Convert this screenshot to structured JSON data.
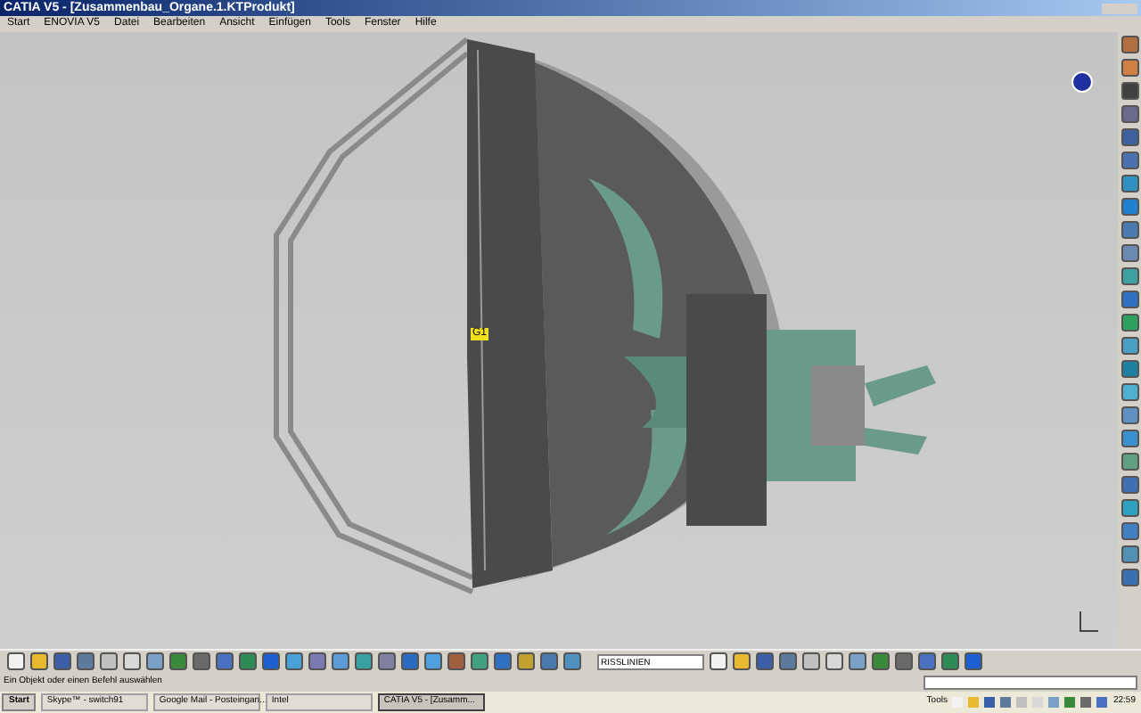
{
  "window": {
    "title": "CATIA V5 - [Zusammenbau_Organe.1.KTProdukt]"
  },
  "menu": [
    "Start",
    "ENOVIA V5",
    "Datei",
    "Bearbeiten",
    "Ansicht",
    "Einfügen",
    "Tools",
    "Fenster",
    "Hilfe"
  ],
  "canvas": {
    "tag": "G1"
  },
  "toolbar": {
    "field_value": "RISSLINIEN"
  },
  "status_bar": {
    "message": "Ein Objekt oder einen Befehl auswählen"
  },
  "taskbar": {
    "start": "Start",
    "tasks": [
      {
        "label": "Skype™ - switch91",
        "selected": false
      },
      {
        "label": "Google Mail - Posteingan...",
        "selected": false
      },
      {
        "label": "Intel",
        "selected": false
      },
      {
        "label": "CATIA V5 - [Zusamm...",
        "selected": true
      }
    ],
    "tray_label": "Tools",
    "clock": "22:59"
  }
}
